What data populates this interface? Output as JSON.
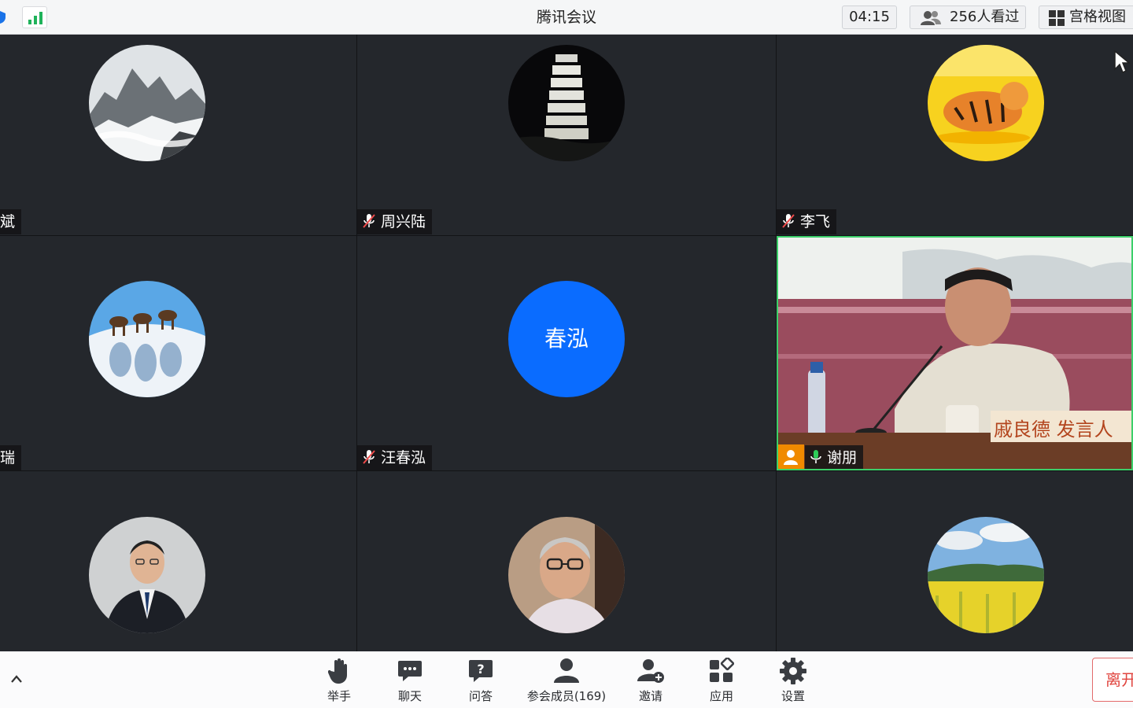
{
  "header": {
    "title": "腾讯会议",
    "timer": "04:15",
    "viewers": "256人看过",
    "grid_view_label": "宫格视图"
  },
  "tiles": [
    {
      "name": "斌",
      "avatar": "mountain-avatar",
      "mic": "muted"
    },
    {
      "name": "周兴陆",
      "avatar": "pagoda-night-avatar",
      "mic": "muted"
    },
    {
      "name": "李飞",
      "avatar": "tiger-painting-avatar",
      "mic": "muted"
    },
    {
      "name": "瑞",
      "avatar": "camels-desert-avatar",
      "mic": "muted"
    },
    {
      "name": "汪春泓",
      "avatar_text": "春泓",
      "avatar_color": "#0a6cff",
      "mic": "muted"
    },
    {
      "name": "谢朋",
      "video": true,
      "mic": "on",
      "host": true,
      "speaking": true,
      "nameplate_text": "戚良德 发言人"
    },
    {
      "name": "",
      "avatar": "man-in-suit-avatar"
    },
    {
      "name": "",
      "avatar": "older-man-glasses-avatar"
    },
    {
      "name": "",
      "avatar": "rapeseed-field-avatar"
    }
  ],
  "toolbar": {
    "items": [
      {
        "label": "举手",
        "icon": "raise-hand-icon"
      },
      {
        "label": "聊天",
        "icon": "chat-icon"
      },
      {
        "label": "问答",
        "icon": "qa-icon"
      },
      {
        "label": "参会成员(169)",
        "icon": "participants-icon"
      },
      {
        "label": "邀请",
        "icon": "invite-icon"
      },
      {
        "label": "应用",
        "icon": "apps-icon"
      },
      {
        "label": "设置",
        "icon": "settings-icon"
      }
    ],
    "leave_label": "离开"
  },
  "colors": {
    "speaking_border": "#3ccf6a",
    "host_badge": "#f08a00",
    "leave": "#e0453f",
    "signal": "#1fb25a"
  }
}
